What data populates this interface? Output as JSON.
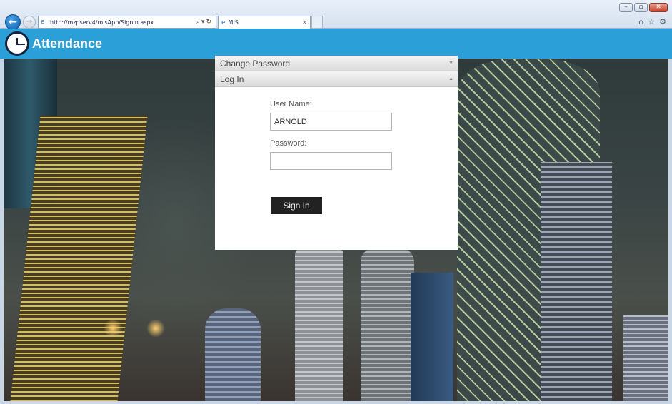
{
  "browser": {
    "url": "http://mzpserv4/misApp/SignIn.aspx",
    "tab_title": "MIS",
    "tab_close": "×",
    "back_icon": "back-arrow-icon",
    "forward_icon": "forward-arrow-icon"
  },
  "app": {
    "title": "Attendance",
    "brand_color": "#2a9fd8"
  },
  "accordion": {
    "change_password": "Change Password",
    "log_in": "Log In"
  },
  "login": {
    "username_label": "User Name:",
    "username_value": "ARNOLD",
    "password_label": "Password:",
    "password_value": "",
    "signin_label": "Sign In"
  }
}
